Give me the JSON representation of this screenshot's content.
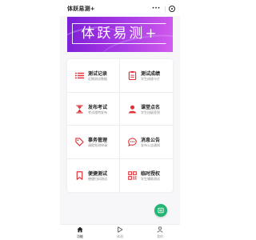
{
  "header": {
    "title": "体跃易测+",
    "more_label": "•••"
  },
  "banner": {
    "text": "体跃易测+"
  },
  "menu": [
    {
      "name": "测试记录",
      "sub": "近期测试数据",
      "icon": "list-icon"
    },
    {
      "name": "测试成绩",
      "sub": "学生成绩卡片",
      "icon": "report-icon"
    },
    {
      "name": "发布考试",
      "sub": "考试理特发布",
      "icon": "hourglass-icon"
    },
    {
      "name": "课堂点名",
      "sub": "学生班级签到",
      "icon": "person-icon"
    },
    {
      "name": "事务管理",
      "sub": "请假免测申请",
      "icon": "tag-icon"
    },
    {
      "name": "消息公告",
      "sub": "发布公告通知",
      "icon": "chat-icon"
    },
    {
      "name": "便捷测试",
      "sub": "便捷扫码测试",
      "icon": "bookmark-icon"
    },
    {
      "name": "临时授权",
      "sub": "学生辅助测试",
      "icon": "grid-icon"
    }
  ],
  "tabs": [
    {
      "label": "功能",
      "icon": "home-icon",
      "active": true
    },
    {
      "label": "体测",
      "icon": "play-icon",
      "active": false
    },
    {
      "label": "我的",
      "icon": "user-icon",
      "active": false
    }
  ],
  "colors": {
    "accent": "#e0343b",
    "brand": "#9b2fe0",
    "fab": "#22b573"
  }
}
